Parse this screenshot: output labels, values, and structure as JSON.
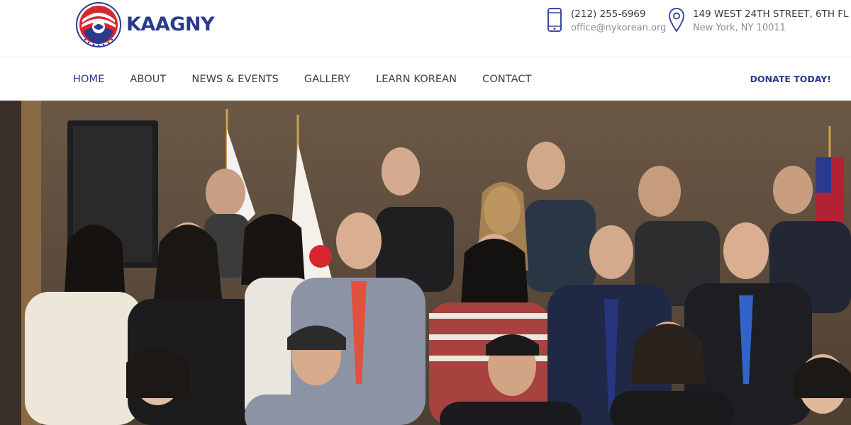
{
  "brand": {
    "name": "KAAGNY",
    "colors": {
      "navy": "#2b3a8c",
      "red": "#d8262e"
    }
  },
  "contact": {
    "phone": "(212) 255-6969",
    "email": "office@nykorean.org",
    "address_line1": "149 WEST 24TH STREET, 6TH FL",
    "address_line2": "New York, NY 10011",
    "phone_icon": "phone-icon",
    "location_icon": "map-pin-icon"
  },
  "nav": {
    "items": [
      {
        "label": "HOME",
        "active": true
      },
      {
        "label": "ABOUT",
        "active": false
      },
      {
        "label": "NEWS & EVENTS",
        "active": false
      },
      {
        "label": "GALLERY",
        "active": false
      },
      {
        "label": "LEARN KOREAN",
        "active": false
      },
      {
        "label": "CONTACT",
        "active": false
      }
    ],
    "donate_label": "DONATE TODAY!"
  },
  "hero": {
    "image": "group-photo"
  }
}
